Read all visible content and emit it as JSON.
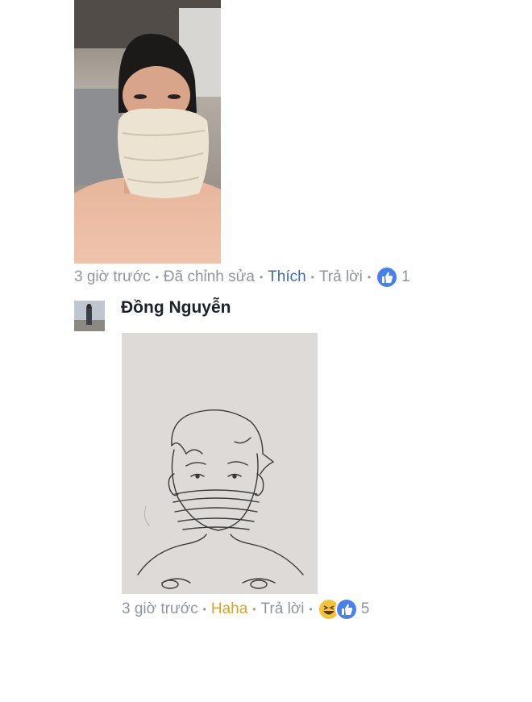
{
  "comment1": {
    "photo_alt": "selfie photo",
    "time": "3 giờ trước",
    "edited": "Đã chỉnh sửa",
    "like_action": "Thích",
    "reply_action": "Trả lời",
    "reactions": [
      "like-icon"
    ],
    "reaction_count": "1"
  },
  "comment2": {
    "author": "Đồng Nguyễn",
    "time": "3 giờ trước",
    "reaction_action": "Haha",
    "reply_action": "Trả lời",
    "reactions": [
      "haha-icon",
      "like-icon"
    ],
    "reaction_count": "5"
  },
  "colors": {
    "meta_gray": "#90949c",
    "like_blue": "#4267b2",
    "haha_yellow": "#d9a520",
    "author_text": "#1d2129"
  }
}
